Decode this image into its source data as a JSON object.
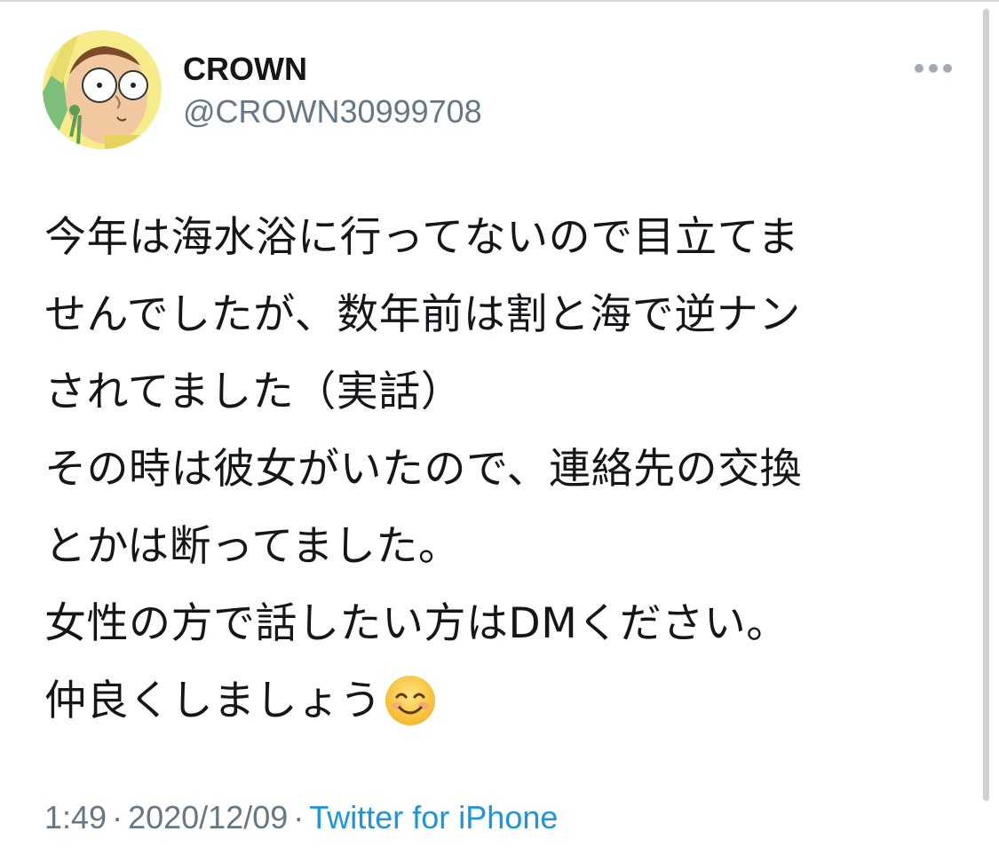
{
  "author": {
    "display_name": "CROWN",
    "handle": "@CROWN30999708",
    "avatar_icon": "cartoon-character-avatar"
  },
  "menu": {
    "icon": "more-options-icon"
  },
  "tweet": {
    "lines": [
      "今年は海水浴に行ってないので目立てま",
      "せんでしたが、数年前は割と海で逆ナン",
      "されてました（実話）",
      "その時は彼女がいたので、連絡先の交換",
      "とかは断ってました。",
      "女性の方で話したい方はDMください。",
      "仲良くしましょう"
    ],
    "emoji": "smiling-face-emoji"
  },
  "meta": {
    "time": "1:49",
    "separator": "·",
    "date": "2020/12/09",
    "source": "Twitter for iPhone"
  },
  "colors": {
    "text": "#14171a",
    "secondary": "#657786",
    "link": "#1b95e0"
  }
}
